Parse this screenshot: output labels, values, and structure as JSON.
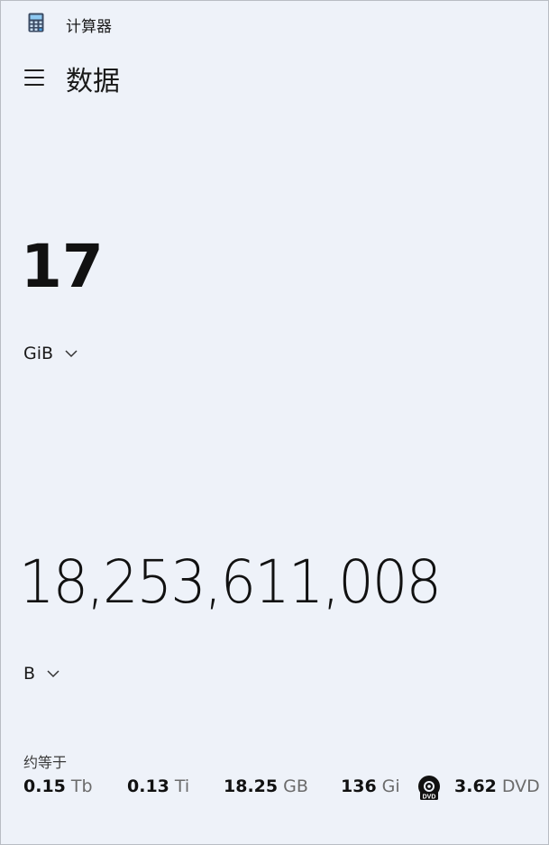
{
  "app": {
    "title": "计算器",
    "icon": "calculator-icon"
  },
  "header": {
    "menu_icon": "hamburger-menu-icon",
    "mode": "数据"
  },
  "input": {
    "value": "17",
    "unit": "GiB"
  },
  "output": {
    "value": "18,253,611,008",
    "unit": "B"
  },
  "approx": {
    "label": "约等于",
    "items": [
      {
        "value": "0.15",
        "unit": "Tb"
      },
      {
        "value": "0.13",
        "unit": "Ti"
      },
      {
        "value": "18.25",
        "unit": "GB"
      },
      {
        "value": "136",
        "unit": "Gi"
      },
      {
        "value": "3.62",
        "unit": "DVD",
        "icon": "dvd-icon"
      }
    ]
  }
}
